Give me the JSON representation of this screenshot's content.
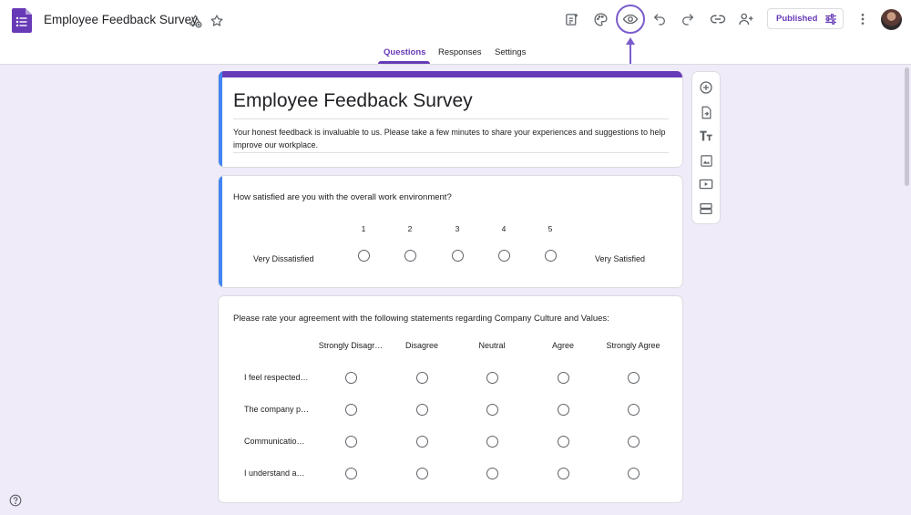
{
  "header": {
    "title": "Employee Feedback Survey",
    "published_label": "Published",
    "icons": [
      "forms-logo-icon",
      "cloud-saved-icon",
      "star-icon",
      "addons-icon",
      "palette-icon",
      "preview-eye-icon",
      "undo-icon",
      "redo-icon",
      "link-icon",
      "add-collaborator-icon",
      "tune-icon",
      "more-vert-icon"
    ]
  },
  "tabs": [
    {
      "label": "Questions",
      "active": true
    },
    {
      "label": "Responses",
      "active": false
    },
    {
      "label": "Settings",
      "active": false
    }
  ],
  "form": {
    "title": "Employee Feedback Survey",
    "description": "Your honest feedback is invaluable to us. Please take a few minutes to share your experiences and suggestions to help improve our workplace."
  },
  "question1": {
    "text": "How satisfied are you with the overall work environment?",
    "scale": [
      "1",
      "2",
      "3",
      "4",
      "5"
    ],
    "low_label": "Very Dissatisfied",
    "high_label": "Very Satisfied"
  },
  "question2": {
    "text": "Please rate your agreement with the following statements regarding Company Culture and Values:",
    "columns": [
      "Strongly Disagr…",
      "Disagree",
      "Neutral",
      "Agree",
      "Strongly Agree"
    ],
    "rows": [
      "I feel respected…",
      "The company p…",
      "Communicatio…",
      "I understand a…"
    ]
  },
  "toolbar": [
    "add-question-icon",
    "import-questions-icon",
    "add-title-icon",
    "add-image-icon",
    "add-video-icon",
    "add-section-icon"
  ],
  "colors": {
    "accent": "#673ab7",
    "focus": "#4285f4",
    "background": "#f0ebf8"
  }
}
